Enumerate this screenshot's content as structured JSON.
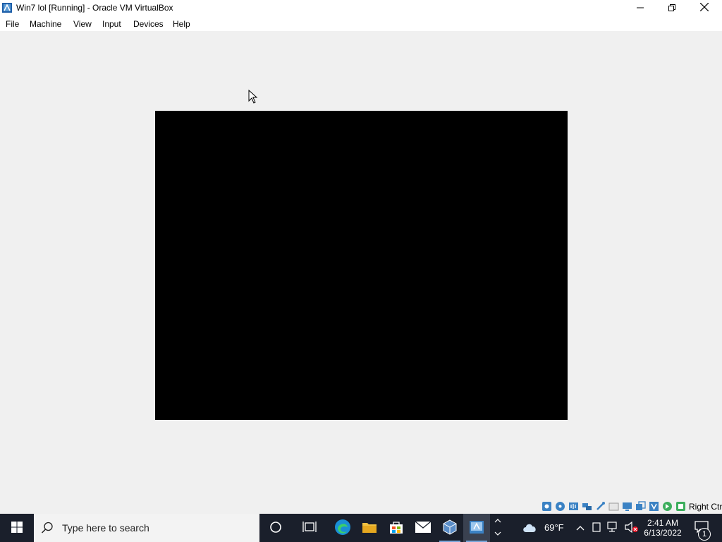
{
  "window": {
    "title": "Win7 lol [Running] - Oracle VM VirtualBox",
    "icon": "virtualbox-icon",
    "controls": [
      "minimize-icon",
      "restore-icon",
      "close-icon"
    ]
  },
  "menubar": {
    "items": [
      {
        "label": "File"
      },
      {
        "label": "Machine"
      },
      {
        "label": "View"
      },
      {
        "label": "Input"
      },
      {
        "label": "Devices"
      },
      {
        "label": "Help"
      }
    ]
  },
  "vm": {
    "screen_color": "#000000"
  },
  "statusbar": {
    "icons": [
      "hard-disk-icon",
      "optical-drive-icon",
      "audio-icon",
      "network-icon",
      "usb-icon",
      "shared-folders-icon",
      "display-icon",
      "recording-icon",
      "vt-x-icon",
      "mouse-integration-icon",
      "keyboard-icon"
    ],
    "host_key": "Right Ctrl"
  },
  "taskbar": {
    "search_placeholder": "Type here to search",
    "pinned": [
      "cortana-icon",
      "task-view-icon",
      "edge-icon",
      "file-explorer-icon",
      "microsoft-store-icon",
      "mail-icon",
      "virtualbox-icon",
      "virtualbox-vm-icon"
    ],
    "weather_temp": "69°F",
    "time": "2:41 AM",
    "date": "6/13/2022",
    "notification_count": "1"
  }
}
